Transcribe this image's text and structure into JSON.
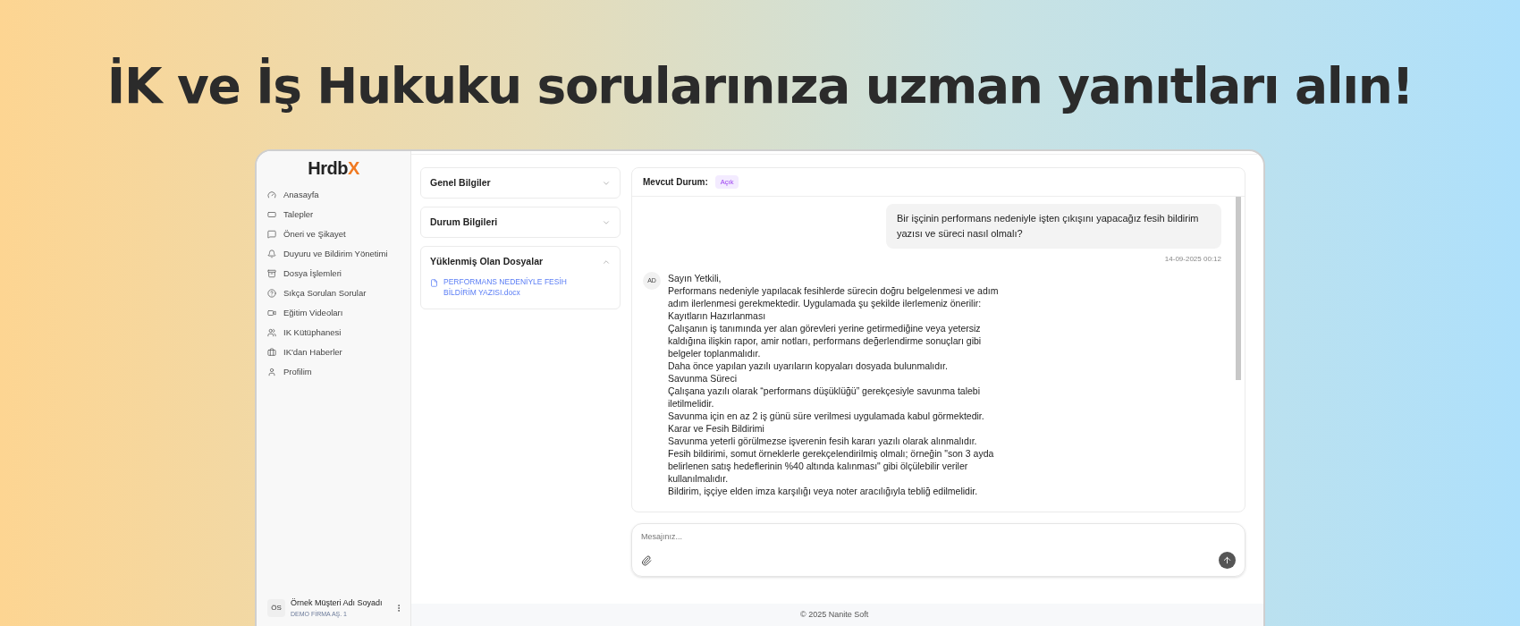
{
  "headline": "İK ve İş Hukuku sorularınıza uzman yanıtları alın!",
  "logo": {
    "text": "Hrdb",
    "accent": "X"
  },
  "sidebar": {
    "items": [
      {
        "label": "Anasayfa"
      },
      {
        "label": "Talepler"
      },
      {
        "label": "Öneri ve Şikayet"
      },
      {
        "label": "Duyuru ve Bildirim Yönetimi"
      },
      {
        "label": "Dosya İşlemleri"
      },
      {
        "label": "Sıkça Sorulan Sorular"
      },
      {
        "label": "Eğitim Videoları"
      },
      {
        "label": "IK Kütüphanesi"
      },
      {
        "label": "IK'dan Haberler"
      },
      {
        "label": "Profilim"
      }
    ],
    "user": {
      "initials": "ÖS",
      "name": "Örnek Müşteri Adı Soyadı",
      "company": "DEMO FİRMA AŞ. 1"
    }
  },
  "panels": [
    {
      "title": "Genel Bilgiler",
      "expanded": false
    },
    {
      "title": "Durum Bilgileri",
      "expanded": false
    },
    {
      "title": "Yüklenmiş Olan Dosyalar",
      "expanded": true,
      "files": [
        "PERFORMANS NEDENİYLE FESİH BİLDİRİM YAZISI.docx"
      ]
    }
  ],
  "chat": {
    "status_label": "Mevcut Durum:",
    "status": "Açık",
    "messages": [
      {
        "kind": "user",
        "text": "Bir işçinin performans nedeniyle işten çıkışını yapacağız fesih bildirim yazısı ve süreci nasıl olmalı?",
        "time": "14-09-2025 00:12"
      },
      {
        "kind": "answer",
        "avatar": "AD",
        "lines": [
          "Sayın Yetkili,",
          "Performans nedeniyle yapılacak fesihlerde sürecin doğru belgelenmesi ve adım adım ilerlenmesi gerekmektedir. Uygulamada şu şekilde ilerlemeniz önerilir:",
          "Kayıtların Hazırlanması",
          "Çalışanın iş tanımında yer alan görevleri yerine getirmediğine veya yetersiz kaldığına ilişkin rapor, amir notları, performans değerlendirme sonuçları gibi belgeler toplanmalıdır.",
          "Daha önce yapılan yazılı uyarıların kopyaları dosyada bulunmalıdır.",
          "Savunma Süreci",
          "Çalışana yazılı olarak “performans düşüklüğü” gerekçesiyle savunma talebi iletilmelidir.",
          "Savunma için en az 2 iş günü süre verilmesi uygulamada kabul görmektedir.",
          "Karar ve Fesih Bildirimi",
          "Savunma yeterli görülmezse işverenin fesih kararı yazılı olarak alınmalıdır.",
          "Fesih bildirimi, somut örneklerle gerekçelendirilmiş olmalı; örneğin \"son 3 ayda belirlenen satış hedeflerinin %40 altında kalınması\" gibi ölçülebilir veriler kullanılmalıdır.",
          "Bildirim, işçiye elden imza karşılığı veya noter aracılığıyla tebliğ edilmelidir."
        ]
      }
    ],
    "input": {
      "placeholder": "Mesajınız..."
    }
  },
  "footer": "© 2025 Nanite Soft"
}
